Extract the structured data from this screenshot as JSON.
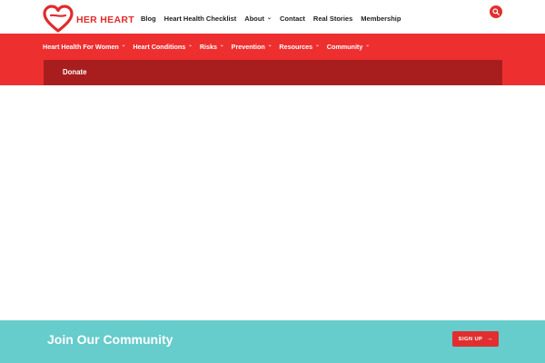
{
  "brand": {
    "logo_text": "HER HEART",
    "accent": "#e02b2b"
  },
  "header": {
    "nav": [
      {
        "label": "Blog",
        "has_dropdown": false
      },
      {
        "label": "Heart Health Checklist",
        "has_dropdown": false
      },
      {
        "label": "About",
        "has_dropdown": true
      },
      {
        "label": "Contact",
        "has_dropdown": false
      },
      {
        "label": "Real Stories",
        "has_dropdown": false
      },
      {
        "label": "Membership",
        "has_dropdown": false
      }
    ],
    "search_icon": "search-icon"
  },
  "category_nav": {
    "background": "#ee2f2f",
    "items": [
      {
        "label": "Heart Health For Women",
        "has_dropdown": true
      },
      {
        "label": "Heart Conditions",
        "has_dropdown": true
      },
      {
        "label": "Risks",
        "has_dropdown": true
      },
      {
        "label": "Prevention",
        "has_dropdown": true
      },
      {
        "label": "Resources",
        "has_dropdown": true
      },
      {
        "label": "Community",
        "has_dropdown": true
      }
    ],
    "donate_label": "Donate",
    "donate_background": "#a81e1e"
  },
  "footer_banner": {
    "title": "Join Our Community",
    "background": "#66cccc",
    "signup_label": "SIGN UP",
    "signup_icon": "arrow-right-icon"
  }
}
